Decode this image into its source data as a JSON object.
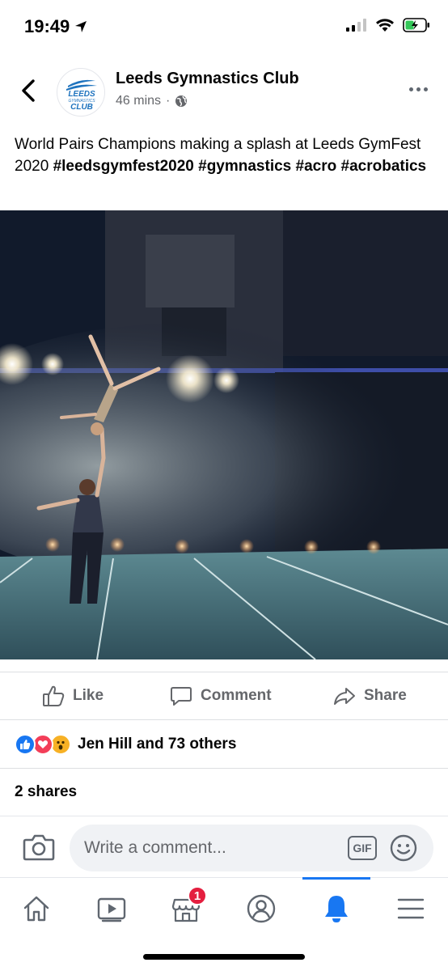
{
  "status_bar": {
    "time": "19:49"
  },
  "post": {
    "page_name": "Leeds Gymnastics Club",
    "time_ago": "46 mins",
    "separator": "·",
    "avatar_logo_text": "LEEDS GYMNASTICS CLUB",
    "caption_text": "World Pairs Champions making a splash at Leeds GymFest 2020",
    "hashtags": [
      "#leedsgymfest2020",
      "#gymnastics",
      "#acro",
      "#acrobatics"
    ]
  },
  "actions": {
    "like_label": "Like",
    "comment_label": "Comment",
    "share_label": "Share"
  },
  "reactions": {
    "summary": "Jen Hill and 73 others",
    "types": [
      "like",
      "love",
      "wow"
    ]
  },
  "shares": {
    "label": "2 shares"
  },
  "composer": {
    "placeholder": "Write a comment...",
    "gif_label": "GIF"
  },
  "tab_bar": {
    "active_tab": "notifications",
    "marketplace_badge": "1"
  },
  "colors": {
    "accent": "#1877f2",
    "badge": "#e41e3f",
    "secondary_text": "#65676b"
  }
}
